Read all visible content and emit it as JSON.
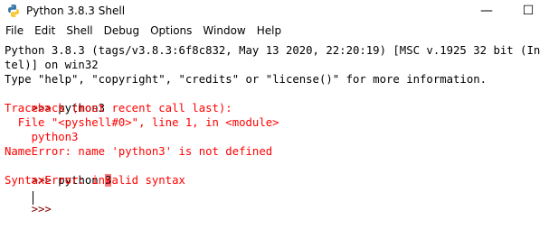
{
  "window": {
    "title": "Python 3.8.3 Shell",
    "controls": {
      "minimize": "—",
      "maximize": "☐"
    }
  },
  "menu": [
    "File",
    "Edit",
    "Shell",
    "Debug",
    "Options",
    "Window",
    "Help"
  ],
  "shell": {
    "banner_1": "Python 3.8.3 (tags/v3.8.3:6f8c832, May 13 2020, 22:20:19) [MSC v.1925 32 bit (In",
    "banner_2": "tel)] on win32",
    "banner_3": "Type \"help\", \"copyright\", \"credits\" or \"license()\" for more information.",
    "prompt": ">>> ",
    "input_1": "python3",
    "tb_1": "Traceback (most recent call last):",
    "tb_2": "  File \"<pyshell#0>\", line 1, in <module>",
    "tb_3": "    python3",
    "tb_4": "NameError: name 'python3' is not defined",
    "input_2_pre": "python ",
    "input_2_hl": "3",
    "err_2": "SyntaxError: invalid syntax"
  },
  "colors": {
    "error": "#ff0000",
    "prompt": "#800000",
    "highlight": "#ff7777"
  }
}
